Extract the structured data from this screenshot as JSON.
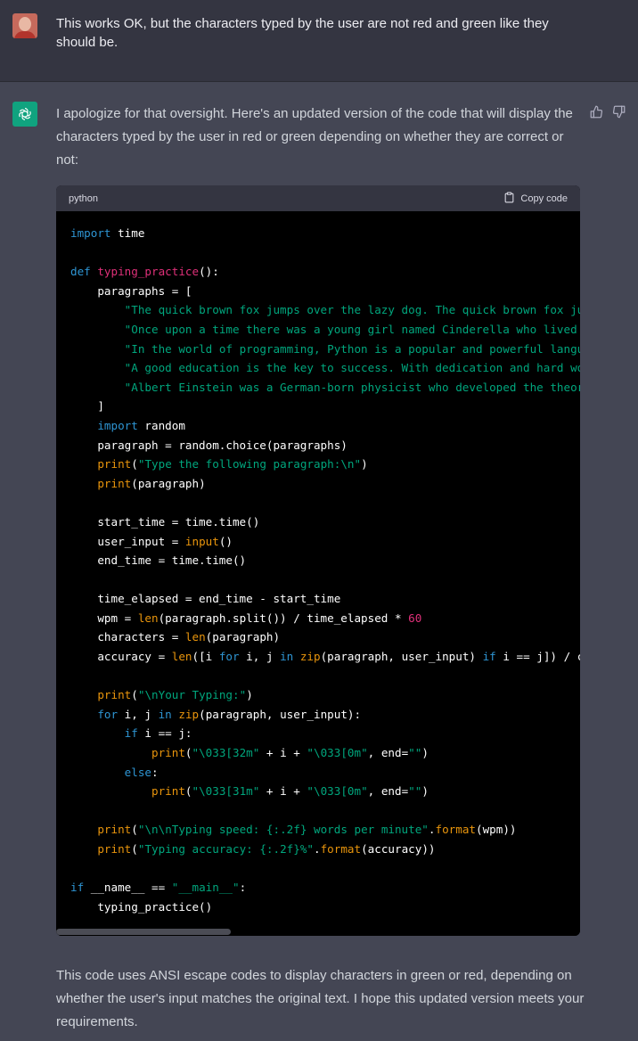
{
  "user_message": {
    "text": "This works OK, but the characters typed by the user are not red and green like they should be."
  },
  "assistant_message": {
    "intro": "I apologize for that oversight. Here's an updated version of the code that will display the characters typed by the user in red or green depending on whether they are correct or not:",
    "code_language": "python",
    "copy_label": "Copy code",
    "code_lines": [
      [
        [
          "kw",
          "import"
        ],
        [
          "p",
          " time"
        ]
      ],
      [],
      [
        [
          "kw",
          "def"
        ],
        [
          "p",
          " "
        ],
        [
          "fn",
          "typing_practice"
        ],
        [
          "p",
          "():"
        ]
      ],
      [
        [
          "p",
          "    paragraphs = ["
        ]
      ],
      [
        [
          "p",
          "        "
        ],
        [
          "st",
          "\"The quick brown fox jumps over the lazy dog. The quick brown fox ju"
        ]
      ],
      [
        [
          "p",
          "        "
        ],
        [
          "st",
          "\"Once upon a time there was a young girl named Cinderella who lived"
        ]
      ],
      [
        [
          "p",
          "        "
        ],
        [
          "st",
          "\"In the world of programming, Python is a popular and powerful langu"
        ]
      ],
      [
        [
          "p",
          "        "
        ],
        [
          "st",
          "\"A good education is the key to success. With dedication and hard wo"
        ]
      ],
      [
        [
          "p",
          "        "
        ],
        [
          "st",
          "\"Albert Einstein was a German-born physicist who developed the theor"
        ]
      ],
      [
        [
          "p",
          "    ]"
        ]
      ],
      [
        [
          "p",
          "    "
        ],
        [
          "kw",
          "import"
        ],
        [
          "p",
          " random"
        ]
      ],
      [
        [
          "p",
          "    paragraph = random.choice(paragraphs)"
        ]
      ],
      [
        [
          "p",
          "    "
        ],
        [
          "bi",
          "print"
        ],
        [
          "p",
          "("
        ],
        [
          "st",
          "\"Type the following paragraph:\\n\""
        ],
        [
          "p",
          ")"
        ]
      ],
      [
        [
          "p",
          "    "
        ],
        [
          "bi",
          "print"
        ],
        [
          "p",
          "(paragraph)"
        ]
      ],
      [],
      [
        [
          "p",
          "    start_time = time.time()"
        ]
      ],
      [
        [
          "p",
          "    user_input = "
        ],
        [
          "bi",
          "input"
        ],
        [
          "p",
          "()"
        ]
      ],
      [
        [
          "p",
          "    end_time = time.time()"
        ]
      ],
      [],
      [
        [
          "p",
          "    time_elapsed = end_time - start_time"
        ]
      ],
      [
        [
          "p",
          "    wpm = "
        ],
        [
          "bi",
          "len"
        ],
        [
          "p",
          "(paragraph.split()) / time_elapsed * "
        ],
        [
          "nu",
          "60"
        ]
      ],
      [
        [
          "p",
          "    characters = "
        ],
        [
          "bi",
          "len"
        ],
        [
          "p",
          "(paragraph)"
        ]
      ],
      [
        [
          "p",
          "    accuracy = "
        ],
        [
          "bi",
          "len"
        ],
        [
          "p",
          "([i "
        ],
        [
          "kw",
          "for"
        ],
        [
          "p",
          " i, j "
        ],
        [
          "kw",
          "in"
        ],
        [
          "p",
          " "
        ],
        [
          "bi",
          "zip"
        ],
        [
          "p",
          "(paragraph, user_input) "
        ],
        [
          "kw",
          "if"
        ],
        [
          "p",
          " i == j]) / c"
        ]
      ],
      [],
      [
        [
          "p",
          "    "
        ],
        [
          "bi",
          "print"
        ],
        [
          "p",
          "("
        ],
        [
          "st",
          "\"\\nYour Typing:\""
        ],
        [
          "p",
          ")"
        ]
      ],
      [
        [
          "p",
          "    "
        ],
        [
          "kw",
          "for"
        ],
        [
          "p",
          " i, j "
        ],
        [
          "kw",
          "in"
        ],
        [
          "p",
          " "
        ],
        [
          "bi",
          "zip"
        ],
        [
          "p",
          "(paragraph, user_input):"
        ]
      ],
      [
        [
          "p",
          "        "
        ],
        [
          "kw",
          "if"
        ],
        [
          "p",
          " i == j:"
        ]
      ],
      [
        [
          "p",
          "            "
        ],
        [
          "bi",
          "print"
        ],
        [
          "p",
          "("
        ],
        [
          "st",
          "\"\\033[32m\""
        ],
        [
          "p",
          " + i + "
        ],
        [
          "st",
          "\"\\033[0m\""
        ],
        [
          "p",
          ", end="
        ],
        [
          "st",
          "\"\""
        ],
        [
          "p",
          ")"
        ]
      ],
      [
        [
          "p",
          "        "
        ],
        [
          "kw",
          "else"
        ],
        [
          "p",
          ":"
        ]
      ],
      [
        [
          "p",
          "            "
        ],
        [
          "bi",
          "print"
        ],
        [
          "p",
          "("
        ],
        [
          "st",
          "\"\\033[31m\""
        ],
        [
          "p",
          " + i + "
        ],
        [
          "st",
          "\"\\033[0m\""
        ],
        [
          "p",
          ", end="
        ],
        [
          "st",
          "\"\""
        ],
        [
          "p",
          ")"
        ]
      ],
      [],
      [
        [
          "p",
          "    "
        ],
        [
          "bi",
          "print"
        ],
        [
          "p",
          "("
        ],
        [
          "st",
          "\"\\n\\nTyping speed: {:.2f} words per minute\""
        ],
        [
          "p",
          "."
        ],
        [
          "bi",
          "format"
        ],
        [
          "p",
          "(wpm))"
        ]
      ],
      [
        [
          "p",
          "    "
        ],
        [
          "bi",
          "print"
        ],
        [
          "p",
          "("
        ],
        [
          "st",
          "\"Typing accuracy: {:.2f}%\""
        ],
        [
          "p",
          "."
        ],
        [
          "bi",
          "format"
        ],
        [
          "p",
          "(accuracy))"
        ]
      ],
      [],
      [
        [
          "kw",
          "if"
        ],
        [
          "p",
          " __name__ == "
        ],
        [
          "st",
          "\"__main__\""
        ],
        [
          "p",
          ":"
        ]
      ],
      [
        [
          "p",
          "    typing_practice()"
        ]
      ]
    ],
    "footer": "This code uses ANSI escape codes to display characters in green or red, depending on whether the user's input matches the original text. I hope this updated version meets your requirements."
  },
  "icons": {
    "user_avatar": "user-avatar",
    "assistant_avatar": "openai-logo-icon",
    "copy": "clipboard-icon",
    "thumbs_up": "thumbs-up-icon",
    "thumbs_down": "thumbs-down-icon"
  },
  "colors": {
    "page_bg": "#444654",
    "user_bg": "#343541",
    "code_bg": "#000000",
    "accent": "#10a37f",
    "keyword": "#2e95d3",
    "function_name": "#df3079",
    "string": "#00a67d",
    "builtin": "#e9950c"
  }
}
